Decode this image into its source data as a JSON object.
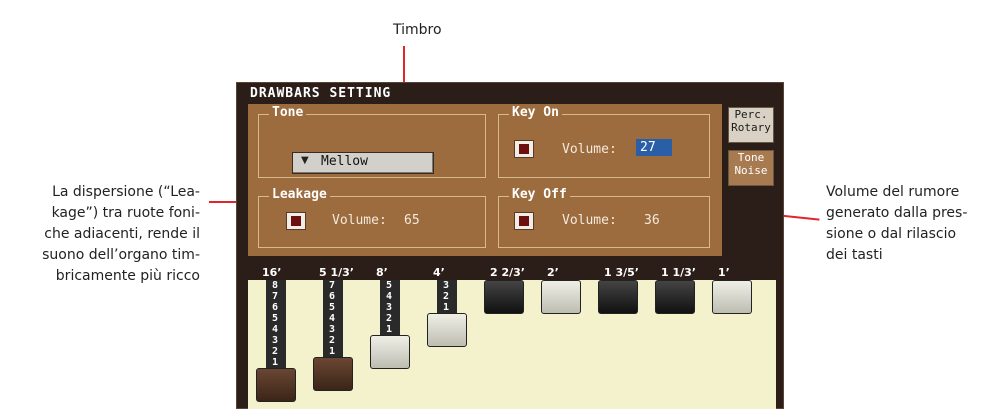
{
  "callouts": {
    "top": "Timbro",
    "left": [
      "La dispersione (“Lea-",
      "kage”) tra ruote foni-",
      "che adiacenti, rende il",
      "suono dell’organo tim-",
      "bricamente più ricco"
    ],
    "right": [
      "Volume del rumore",
      "generato dalla pres-",
      "sione o dal rilascio",
      "dei tasti"
    ]
  },
  "screen": {
    "title": "DRAWBARS SETTING",
    "tone": {
      "label": "Tone",
      "value": "Mellow"
    },
    "leakage": {
      "label": "Leakage",
      "volume_label": "Volume:",
      "volume": "65"
    },
    "key_on": {
      "label": "Key On",
      "volume_label": "Volume:",
      "volume": "27"
    },
    "key_off": {
      "label": "Key Off",
      "volume_label": "Volume:",
      "volume": "36"
    },
    "tabs": {
      "perc_line1": "Perc.",
      "perc_line2": "Rotary",
      "noise_line1": "Tone",
      "noise_line2": "Noise"
    },
    "drawbars": [
      {
        "foot": "16’",
        "level": 8,
        "color": "brown"
      },
      {
        "foot": "5 1/3’",
        "level": 7,
        "color": "brown"
      },
      {
        "foot": "8’",
        "level": 5,
        "color": "white"
      },
      {
        "foot": "4’",
        "level": 3,
        "color": "white"
      },
      {
        "foot": "2 2/3’",
        "level": 0,
        "color": "black"
      },
      {
        "foot": "2’",
        "level": 0,
        "color": "white"
      },
      {
        "foot": "1 3/5’",
        "level": 0,
        "color": "black"
      },
      {
        "foot": "1 1/3’",
        "level": 0,
        "color": "black"
      },
      {
        "foot": "1’",
        "level": 0,
        "color": "white"
      }
    ]
  },
  "colors": {
    "callout_line": "#e1252c",
    "panel": "#9c6b3e",
    "screen_bg": "#2b1e19",
    "draw_area": "#f3f2cc",
    "selection": "#2a5fa8"
  }
}
